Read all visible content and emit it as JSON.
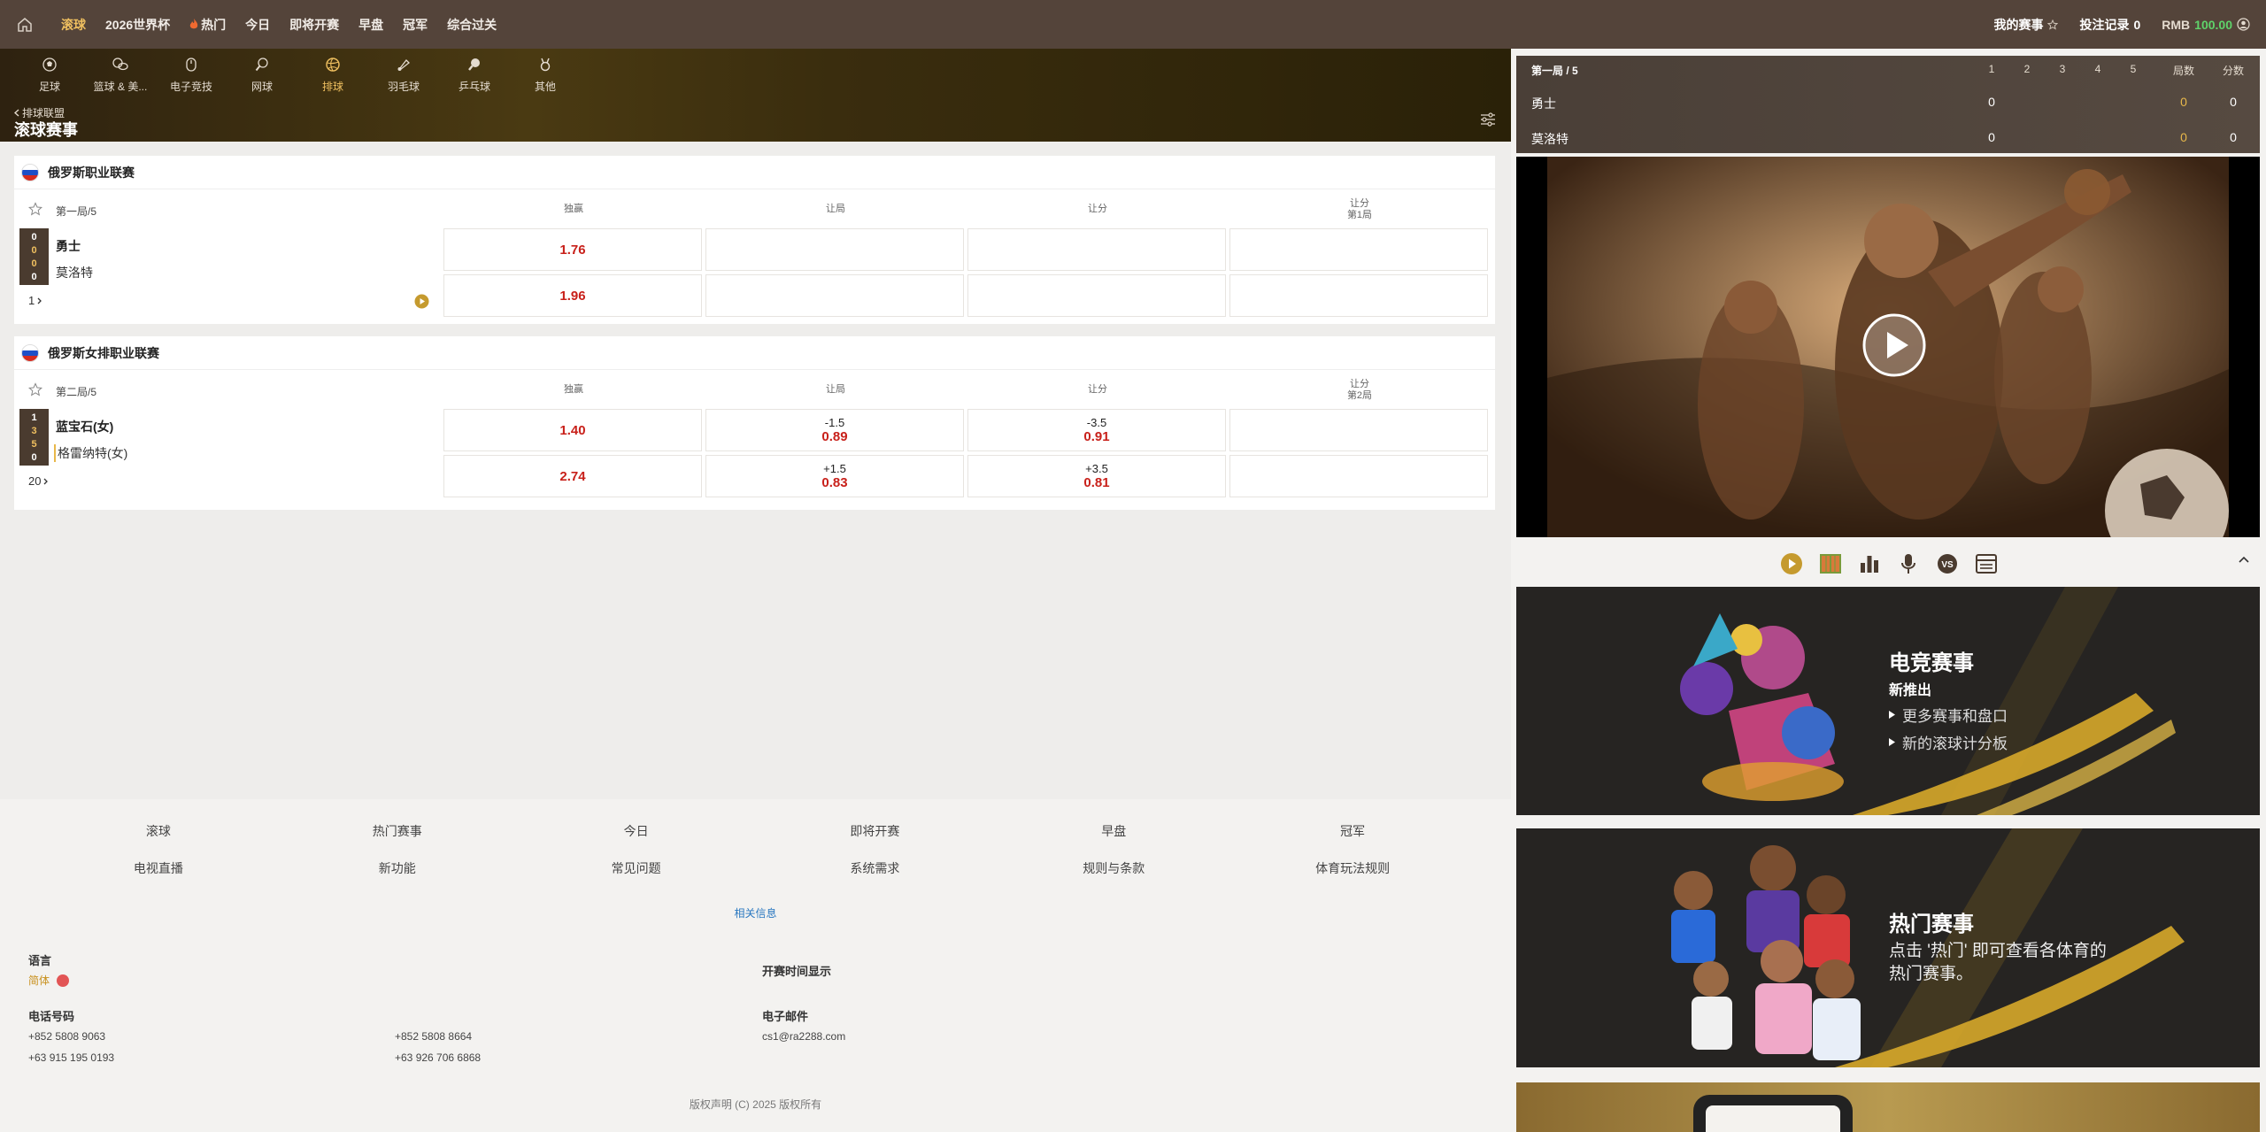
{
  "topnav": {
    "items": [
      {
        "label": "滚球",
        "active": true
      },
      {
        "label": "2026世界杯",
        "active": false
      },
      {
        "label": "热门",
        "active": false,
        "hot": true
      },
      {
        "label": "今日",
        "active": false
      },
      {
        "label": "即将开赛",
        "active": false
      },
      {
        "label": "早盘",
        "active": false
      },
      {
        "label": "冠军",
        "active": false
      },
      {
        "label": "综合过关",
        "active": false
      }
    ],
    "my_events": "我的赛事",
    "bet_records": "投注记录",
    "bet_count": "0",
    "currency": "RMB",
    "balance": "100.00"
  },
  "sports": [
    {
      "label": "足球",
      "icon": "soccer-icon"
    },
    {
      "label": "篮球 & 美...",
      "icon": "basketball-icon"
    },
    {
      "label": "电子竞技",
      "icon": "esports-icon"
    },
    {
      "label": "网球",
      "icon": "tennis-icon"
    },
    {
      "label": "排球",
      "icon": "volleyball-icon",
      "active": true
    },
    {
      "label": "羽毛球",
      "icon": "badminton-icon"
    },
    {
      "label": "乒乓球",
      "icon": "table-tennis-icon"
    },
    {
      "label": "其他",
      "icon": "medal-icon"
    }
  ],
  "breadcrumb": "排球联盟",
  "page_title": "滚球赛事",
  "leagues": [
    {
      "name": "俄罗斯职业联赛",
      "period": "第一局/5",
      "columns": [
        "独赢",
        "让局",
        "让分",
        "让分",
        "第1局"
      ],
      "team1": "勇士",
      "team2": "莫洛特",
      "scores": [
        "0",
        "0",
        "0",
        "0"
      ],
      "more": "1",
      "rows": [
        {
          "moneyline": "1.76",
          "set_line": "",
          "set_price": "",
          "pt_line": "",
          "pt_price": ""
        },
        {
          "moneyline": "1.96",
          "set_line": "",
          "set_price": "",
          "pt_line": "",
          "pt_price": ""
        }
      ]
    },
    {
      "name": "俄罗斯女排职业联赛",
      "period": "第二局/5",
      "columns": [
        "独赢",
        "让局",
        "让分",
        "让分",
        "第2局"
      ],
      "team1": "蓝宝石(女)",
      "team2": "格雷纳特(女)",
      "scores": [
        "1",
        "3",
        "5",
        "0"
      ],
      "more": "20",
      "rows": [
        {
          "moneyline": "1.40",
          "set_line": "-1.5",
          "set_price": "0.89",
          "pt_line": "-3.5",
          "pt_price": "0.91"
        },
        {
          "moneyline": "2.74",
          "set_line": "+1.5",
          "set_price": "0.83",
          "pt_line": "+3.5",
          "pt_price": "0.81"
        }
      ]
    }
  ],
  "footer": {
    "links": [
      "滚球",
      "热门赛事",
      "今日",
      "即将开赛",
      "早盘",
      "冠军",
      "电视直播",
      "新功能",
      "常见问题",
      "系统需求",
      "规则与条款",
      "体育玩法规则"
    ],
    "related": "相关信息",
    "language_label": "语言",
    "language_value": "简体",
    "time_label": "开赛时间显示",
    "phone_label": "电话号码",
    "phones": [
      "+852 5808 9063",
      "+852 5808 8664",
      "+63 915 195 0193",
      "+63 926 706 6868"
    ],
    "email_label": "电子邮件",
    "email": "cs1@ra2288.com",
    "copyright": "版权声明 (C) 2025 版权所有"
  },
  "scoreboard": {
    "period": "第一局 / 5",
    "set_headers": [
      "1",
      "2",
      "3",
      "4",
      "5"
    ],
    "games_label": "局数",
    "points_label": "分数",
    "team1": "勇士",
    "team2": "莫洛特",
    "team1_set1": "0",
    "team2_set1": "0",
    "team1_games": "0",
    "team2_games": "0",
    "team1_points": "0",
    "team2_points": "0"
  },
  "promos": {
    "esports": {
      "title": "电竞赛事",
      "subtitle": "新推出",
      "lines": [
        "更多赛事和盘口",
        "新的滚球计分板"
      ]
    },
    "hot": {
      "title": "热门赛事",
      "text": "点击 '热门' 即可查看各体育的热门赛事。"
    }
  },
  "colors": {
    "accent": "#f0c060",
    "odds": "#c8201a",
    "nav_bg": "#54443a",
    "balance": "#5fd36a"
  }
}
